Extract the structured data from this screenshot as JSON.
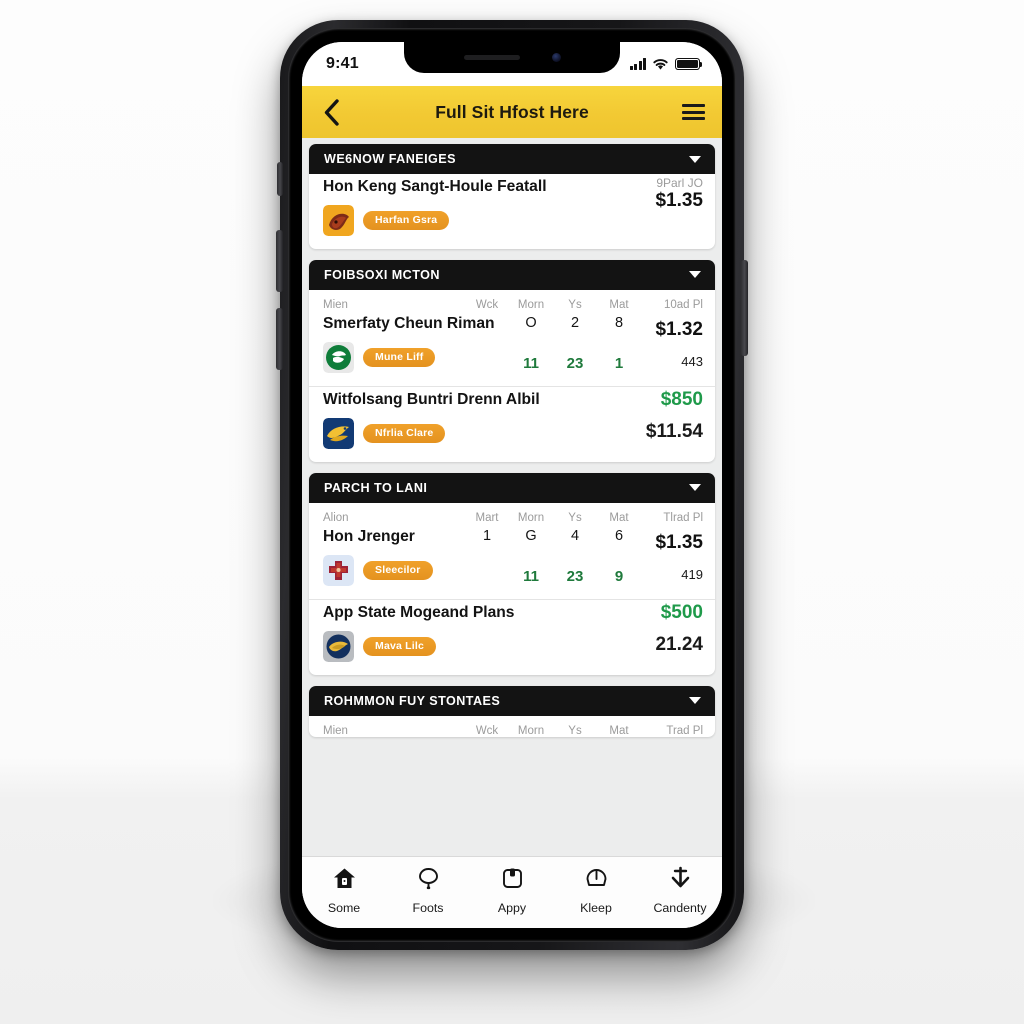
{
  "status_bar": {
    "time": "9:41",
    "signal_icon": "cellular-bars-icon",
    "wifi_icon": "wifi-icon",
    "battery_icon": "battery-full-icon"
  },
  "app_bar": {
    "back_icon": "chevron-left-icon",
    "title": "Full Sit Hfost Here",
    "menu_icon": "hamburger-menu-icon"
  },
  "sections": [
    {
      "header": "WE6NOW FANEIGES",
      "chevron_icon": "chevron-down-icon",
      "columns": null,
      "rows": [
        {
          "title": "Hon Keng Sangt-Houle Featall",
          "logo_icon": "team-logo-maroon-icon",
          "tag": "Harfan Gsra",
          "stats": [],
          "price_label": "9Parl JO",
          "price_main": "$1.35",
          "price_main_green": false,
          "price_sub": ""
        }
      ]
    },
    {
      "header": "FOIBSOXI MCTON",
      "chevron_icon": "chevron-down-icon",
      "columns": [
        "Mien",
        "Wck",
        "Morn",
        "Ys",
        "Mat",
        "10ad Pl"
      ],
      "rows": [
        {
          "title": "Smerfaty Cheun Riman",
          "logo_icon": "team-logo-green-icon",
          "tag": "Mune Liff",
          "stats": [
            {
              "top": "",
              "bottom": ""
            },
            {
              "top": "O",
              "bottom": "11"
            },
            {
              "top": "2",
              "bottom": "23"
            },
            {
              "top": "8",
              "bottom": "1"
            }
          ],
          "price_label": "",
          "price_main": "$1.32",
          "price_main_green": false,
          "price_sub": "443"
        },
        {
          "title": "Witfolsang Buntri Drenn Albil",
          "logo_icon": "team-logo-blue-eagle-icon",
          "tag": "Nfrlia Clare",
          "stats": [],
          "price_label": "",
          "price_main": "$850",
          "price_main_green": true,
          "price_sub": "$11.54"
        }
      ]
    },
    {
      "header": "PARCH TO LANI",
      "chevron_icon": "chevron-down-icon",
      "columns": [
        "Alion",
        "Mart",
        "Morn",
        "Ys",
        "Mat",
        "Tlrad Pl"
      ],
      "rows": [
        {
          "title": "Hon Jrenger",
          "logo_icon": "team-logo-red-cross-icon",
          "tag": "Sleecilor",
          "stats": [
            {
              "top": "1",
              "bottom": ""
            },
            {
              "top": "G",
              "bottom": "11"
            },
            {
              "top": "4",
              "bottom": "23"
            },
            {
              "top": "6",
              "bottom": "9"
            }
          ],
          "price_label": "",
          "price_main": "$1.35",
          "price_main_green": false,
          "price_sub": "419"
        },
        {
          "title": "App State Mogeand Plans",
          "logo_icon": "team-logo-navy-gold-icon",
          "tag": "Mava Lilc",
          "stats": [],
          "price_label": "",
          "price_main": "$500",
          "price_main_green": true,
          "price_sub": "21.24"
        }
      ]
    },
    {
      "header": "ROHMMON FUY STONTAES",
      "chevron_icon": "chevron-down-icon",
      "columns": [
        "Mien",
        "Wck",
        "Morn",
        "Ys",
        "Mat",
        "Trad Pl"
      ],
      "rows": []
    }
  ],
  "tab_bar": {
    "tabs": [
      {
        "label": "Some",
        "icon": "home-icon"
      },
      {
        "label": "Foots",
        "icon": "balloon-icon"
      },
      {
        "label": "Appy",
        "icon": "clipboard-icon"
      },
      {
        "label": "Kleep",
        "icon": "gauge-icon"
      },
      {
        "label": "Candenty",
        "icon": "download-arrow-icon"
      }
    ]
  },
  "colors": {
    "accent_yellow": "#f2c933",
    "header_black": "#131313",
    "tag_orange": "#e4921f",
    "stat_green": "#1f7a3c",
    "price_green": "#1f9a4a"
  }
}
